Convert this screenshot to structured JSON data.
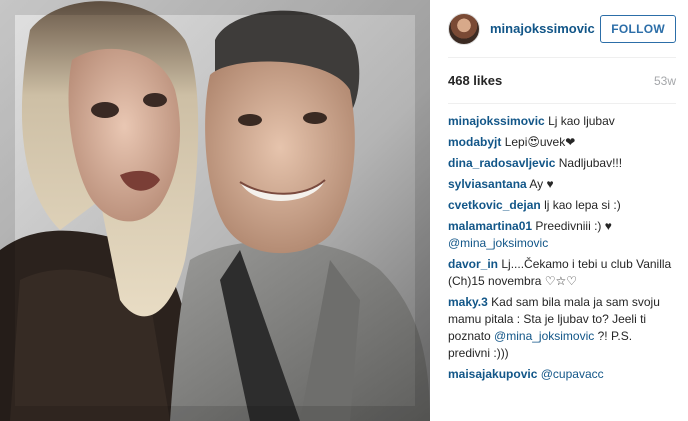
{
  "post": {
    "username": "minajokssimovic",
    "follow_label": "FOLLOW",
    "likes": "468 likes",
    "time": "53w"
  },
  "comments": [
    {
      "user": "minajokssimovic",
      "text": "Lj kao ljubav"
    },
    {
      "user": "modabyjt",
      "text": "Lepi😍uvek❤"
    },
    {
      "user": "dina_radosavljevic",
      "text": "Nadljubav!!!"
    },
    {
      "user": "sylviasantana",
      "text": "Ay ♥"
    },
    {
      "user": "cvetkovic_dejan",
      "text": "lj kao lepa si :)"
    },
    {
      "user": "malamartina01",
      "text": "Preedivniii :) ♥",
      "mention": "@mina_joksimovic",
      "text_after": ""
    },
    {
      "user": "davor_in",
      "text": "Lj....Čekamo i tebi u club Vanilla (Ch)15 novembra ♡☆♡"
    },
    {
      "user": "maky.3",
      "text": "Kad sam bila mala ja sam svoju mamu pitala : Sta je ljubav to? Jeeli ti poznato",
      "mention": "@mina_joksimovic",
      "text_after": " ?! P.S. predivni :)))"
    },
    {
      "user": "maisajakupovic",
      "text": "",
      "mention": "@cupavacc",
      "text_after": ""
    }
  ],
  "colors": {
    "link": "#125688",
    "follow": "#2c6ea8",
    "muted": "#a5a7aa"
  }
}
